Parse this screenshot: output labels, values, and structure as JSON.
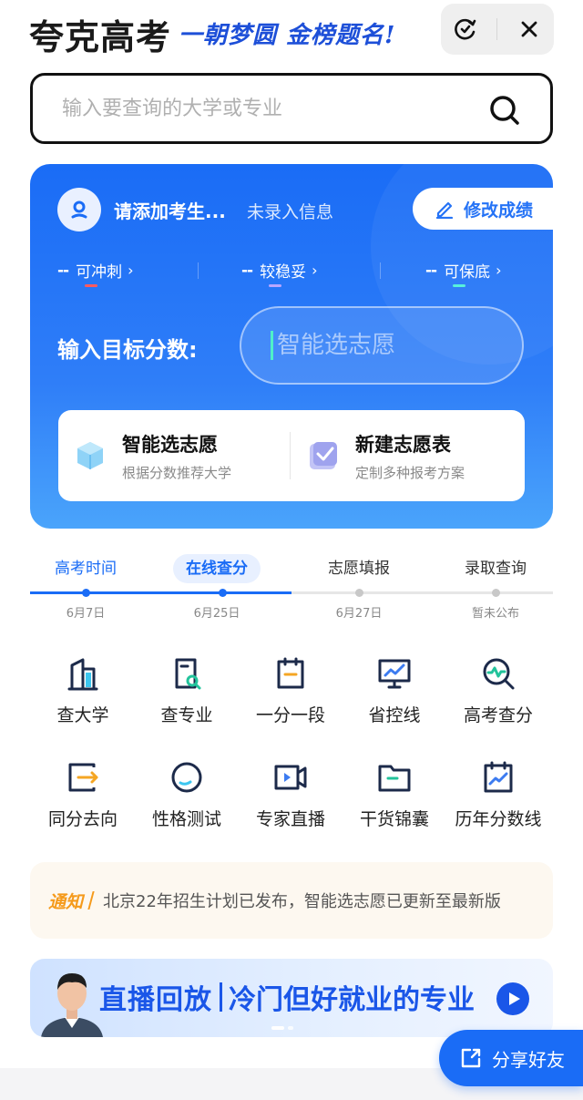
{
  "header": {
    "title": "夸克高考",
    "slogan": "一朝梦圆 金榜题名!",
    "icons": [
      "refresh-check-icon",
      "close-icon"
    ]
  },
  "search": {
    "placeholder": "输入要查询的大学或专业",
    "icon": "search-icon"
  },
  "profile": {
    "name": "请添加考生...",
    "info": "未录入信息",
    "edit_label": "修改成绩"
  },
  "levels": [
    {
      "value": "--",
      "label": "可冲刺",
      "color": "#ff5a5f"
    },
    {
      "value": "--",
      "label": "较稳妥",
      "color": "#b9a6ff"
    },
    {
      "value": "--",
      "label": "可保底",
      "color": "#4ff0d8"
    }
  ],
  "score": {
    "label": "输入目标分数:",
    "placeholder": "智能选志愿"
  },
  "actions": [
    {
      "title": "智能选志愿",
      "subtitle": "根据分数推荐大学"
    },
    {
      "title": "新建志愿表",
      "subtitle": "定制多种报考方案"
    }
  ],
  "timeline": [
    {
      "label": "高考时间",
      "date": "6月7日"
    },
    {
      "label": "在线查分",
      "date": "6月25日"
    },
    {
      "label": "志愿填报",
      "date": "6月27日"
    },
    {
      "label": "录取查询",
      "date": "暂未公布"
    }
  ],
  "tools": [
    {
      "label": "查大学",
      "icon": "building-icon"
    },
    {
      "label": "查专业",
      "icon": "document-search-icon"
    },
    {
      "label": "一分一段",
      "icon": "score-segment-icon"
    },
    {
      "label": "省控线",
      "icon": "monitor-chart-icon"
    },
    {
      "label": "高考查分",
      "icon": "search-wave-icon"
    },
    {
      "label": "同分去向",
      "icon": "arrow-exit-icon"
    },
    {
      "label": "性格测试",
      "icon": "circle-test-icon"
    },
    {
      "label": "专家直播",
      "icon": "video-camera-icon"
    },
    {
      "label": "干货锦囊",
      "icon": "folder-icon"
    },
    {
      "label": "历年分数线",
      "icon": "history-chart-icon"
    }
  ],
  "notice": {
    "tag": "通知",
    "text": "北京22年招生计划已发布，智能选志愿已更新至最新版"
  },
  "banner": {
    "title": "直播回放",
    "subtitle": "冷门但好就业的专业"
  },
  "share": {
    "label": "分享好友"
  },
  "colors": {
    "primary": "#1a6cf6",
    "notice": "#f59a1b"
  }
}
